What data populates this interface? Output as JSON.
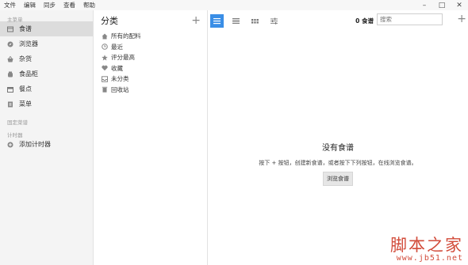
{
  "menubar": {
    "items": [
      "文件",
      "编辑",
      "同步",
      "查看",
      "帮助"
    ]
  },
  "window_controls": {
    "minimize": "–",
    "maximize": "□",
    "close": "✕"
  },
  "sidebar": {
    "main_header": "主菜单",
    "items": [
      {
        "label": "食谱",
        "icon": "recipe-icon",
        "active": true
      },
      {
        "label": "浏览器",
        "icon": "compass-icon",
        "active": false
      },
      {
        "label": "杂货",
        "icon": "basket-icon",
        "active": false
      },
      {
        "label": "食品柜",
        "icon": "jar-icon",
        "active": false
      },
      {
        "label": "餐点",
        "icon": "calendar-icon",
        "active": false
      },
      {
        "label": "菜单",
        "icon": "menu-book-icon",
        "active": false
      }
    ],
    "pinned_header": "固定菜谱",
    "timer_header": "计时器",
    "add_timer_label": "添加计时器"
  },
  "categories": {
    "title": "分类",
    "add": "+",
    "items": [
      {
        "label": "所有的配料",
        "icon": "home-icon"
      },
      {
        "label": "最近",
        "icon": "clock-icon"
      },
      {
        "label": "评分最高",
        "icon": "star-icon"
      },
      {
        "label": "收藏",
        "icon": "heart-icon"
      },
      {
        "label": "未分类",
        "icon": "inbox-icon"
      },
      {
        "label": "回收站",
        "icon": "trash-icon"
      }
    ]
  },
  "content": {
    "count_label": "0 食谱",
    "search_placeholder": "搜索",
    "add": "+",
    "empty_title": "没有食谱",
    "empty_desc": "按下 + 按钮，创建新食谱，或者按下下列按钮，在线浏览食谱。",
    "browse_button": "浏览食谱"
  },
  "watermark": {
    "line1": "脚本之家",
    "line2": "www.jb51.net"
  },
  "colors": {
    "accent": "#3a8ee6",
    "watermark": "#d24b3a"
  }
}
